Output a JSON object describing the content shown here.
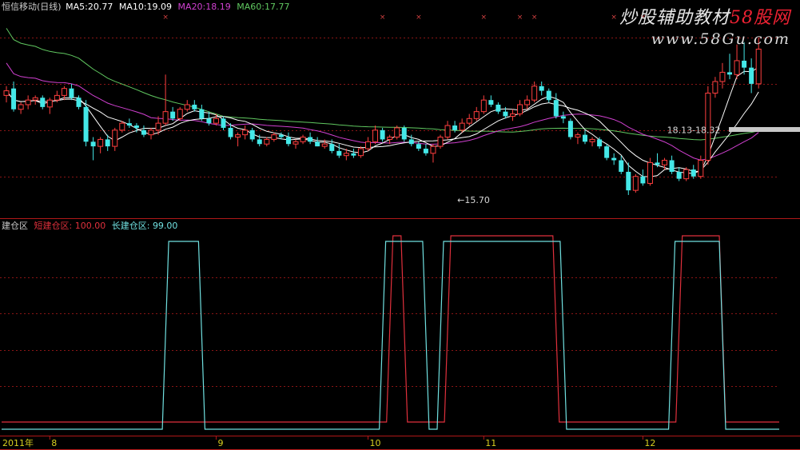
{
  "colors": {
    "background": "#000000",
    "up": "#ff3f3f",
    "down": "#44e8e8",
    "ma5": "#ffffff",
    "ma10": "#ffffff",
    "ma20": "#d040d0",
    "ma60": "#60c860",
    "grid": "#8a1515",
    "text": "#cccccc",
    "short_zone": "#e0303c",
    "long_zone": "#70e0e0"
  },
  "watermark": {
    "line1_a": "炒股辅助教材",
    "line1_b": "58股网",
    "line2": "www.58Gu.com"
  },
  "chart_data": [
    {
      "type": "candlestick",
      "title": "恒信移动(日线)",
      "legend": [
        {
          "label": "MA5:",
          "value": "20.77",
          "color_key": "ma5"
        },
        {
          "label": "MA10:",
          "value": "19.09",
          "color_key": "ma10"
        },
        {
          "label": "MA20:",
          "value": "18.19",
          "color_key": "ma20"
        },
        {
          "label": "MA60:",
          "value": "17.77",
          "color_key": "ma60"
        }
      ],
      "ylim": [
        14.8,
        23.5
      ],
      "grid": true,
      "annotations": [
        {
          "text": "←15.70",
          "x": 63,
          "y": 15.7
        },
        {
          "text": "18.13-18.32",
          "x": 92,
          "y": 18.3
        }
      ],
      "candles": [
        [
          20.0,
          20.4,
          19.7,
          20.2
        ],
        [
          20.3,
          20.6,
          19.3,
          19.4
        ],
        [
          19.4,
          19.7,
          19.2,
          19.6
        ],
        [
          19.6,
          20.0,
          19.4,
          19.8
        ],
        [
          19.8,
          20.0,
          19.6,
          19.9
        ],
        [
          19.9,
          20.0,
          19.4,
          19.5
        ],
        [
          19.5,
          19.9,
          19.2,
          19.8
        ],
        [
          19.8,
          20.2,
          19.7,
          20.0
        ],
        [
          20.0,
          20.4,
          19.8,
          20.3
        ],
        [
          20.3,
          20.5,
          19.8,
          19.9
        ],
        [
          19.9,
          20.0,
          19.4,
          19.5
        ],
        [
          19.5,
          19.8,
          17.8,
          18.0
        ],
        [
          18.0,
          18.2,
          17.2,
          17.8
        ],
        [
          17.8,
          18.2,
          17.5,
          18.1
        ],
        [
          18.1,
          18.3,
          17.6,
          17.8
        ],
        [
          17.8,
          18.6,
          17.6,
          18.5
        ],
        [
          18.5,
          18.9,
          18.4,
          18.8
        ],
        [
          18.8,
          19.0,
          18.6,
          18.7
        ],
        [
          18.7,
          18.8,
          18.4,
          18.6
        ],
        [
          18.5,
          18.7,
          18.2,
          18.3
        ],
        [
          18.3,
          18.6,
          18.1,
          18.5
        ],
        [
          18.5,
          19.1,
          18.3,
          18.8
        ],
        [
          18.8,
          20.9,
          18.7,
          19.3
        ],
        [
          19.3,
          19.5,
          18.9,
          19.0
        ],
        [
          19.0,
          19.5,
          18.9,
          19.4
        ],
        [
          19.4,
          19.8,
          19.3,
          19.6
        ],
        [
          19.6,
          19.8,
          19.3,
          19.4
        ],
        [
          19.4,
          19.6,
          18.9,
          19.0
        ],
        [
          19.0,
          19.3,
          18.7,
          18.8
        ],
        [
          18.8,
          19.2,
          18.7,
          19.0
        ],
        [
          19.0,
          19.1,
          18.5,
          18.6
        ],
        [
          18.6,
          18.8,
          18.1,
          18.2
        ],
        [
          18.2,
          18.4,
          17.8,
          18.3
        ],
        [
          18.3,
          18.7,
          18.1,
          18.5
        ],
        [
          18.5,
          18.6,
          18.0,
          18.1
        ],
        [
          18.1,
          18.3,
          17.8,
          17.9
        ],
        [
          17.9,
          18.2,
          17.8,
          18.1
        ],
        [
          18.1,
          18.4,
          18.0,
          18.3
        ],
        [
          18.3,
          18.4,
          18.1,
          18.2
        ],
        [
          18.2,
          18.4,
          17.8,
          17.9
        ],
        [
          17.9,
          18.1,
          17.7,
          18.0
        ],
        [
          18.0,
          18.3,
          17.9,
          18.2
        ],
        [
          18.2,
          18.4,
          17.9,
          18.0
        ],
        [
          18.0,
          18.2,
          17.8,
          17.8
        ],
        [
          17.8,
          18.1,
          17.7,
          17.9
        ],
        [
          17.9,
          18.1,
          17.5,
          17.6
        ],
        [
          17.6,
          17.9,
          17.3,
          17.4
        ],
        [
          17.4,
          17.7,
          17.2,
          17.5
        ],
        [
          17.5,
          17.7,
          17.3,
          17.4
        ],
        [
          17.4,
          17.8,
          17.3,
          17.7
        ],
        [
          17.7,
          18.2,
          17.6,
          18.0
        ],
        [
          18.0,
          18.7,
          17.9,
          18.5
        ],
        [
          18.5,
          18.6,
          18.0,
          18.1
        ],
        [
          18.1,
          18.3,
          17.9,
          18.2
        ],
        [
          18.2,
          18.7,
          18.1,
          18.6
        ],
        [
          18.6,
          18.7,
          18.0,
          18.1
        ],
        [
          18.1,
          18.3,
          17.8,
          17.9
        ],
        [
          17.9,
          18.0,
          17.6,
          17.7
        ],
        [
          17.7,
          17.9,
          17.4,
          17.5
        ],
        [
          17.5,
          17.9,
          17.1,
          17.8
        ],
        [
          17.8,
          18.3,
          17.7,
          18.2
        ],
        [
          18.2,
          18.9,
          18.1,
          18.7
        ],
        [
          18.7,
          18.9,
          18.4,
          18.5
        ],
        [
          18.5,
          19.0,
          18.4,
          18.8
        ],
        [
          18.8,
          19.2,
          18.7,
          19.0
        ],
        [
          19.0,
          19.5,
          18.9,
          19.3
        ],
        [
          19.3,
          20.0,
          19.2,
          19.8
        ],
        [
          19.8,
          20.0,
          19.5,
          19.6
        ],
        [
          19.6,
          19.7,
          19.2,
          19.3
        ],
        [
          19.3,
          19.5,
          19.0,
          19.1
        ],
        [
          19.1,
          19.4,
          18.9,
          19.2
        ],
        [
          19.2,
          19.8,
          19.1,
          19.6
        ],
        [
          19.6,
          20.0,
          19.4,
          19.8
        ],
        [
          19.8,
          20.6,
          19.7,
          20.4
        ],
        [
          20.4,
          20.6,
          20.0,
          20.2
        ],
        [
          20.2,
          20.3,
          19.7,
          19.8
        ],
        [
          19.8,
          20.1,
          19.0,
          19.1
        ],
        [
          19.1,
          19.3,
          18.8,
          19.0
        ],
        [
          18.9,
          19.0,
          18.1,
          18.2
        ],
        [
          18.2,
          18.4,
          17.9,
          18.3
        ],
        [
          18.3,
          18.5,
          17.9,
          18.0
        ],
        [
          18.0,
          18.2,
          17.8,
          18.1
        ],
        [
          18.1,
          18.2,
          17.7,
          17.8
        ],
        [
          17.8,
          17.9,
          17.2,
          17.3
        ],
        [
          17.3,
          17.5,
          17.0,
          17.2
        ],
        [
          17.2,
          17.4,
          16.6,
          16.7
        ],
        [
          16.7,
          17.1,
          15.7,
          15.9
        ],
        [
          15.9,
          16.6,
          15.8,
          16.5
        ],
        [
          16.5,
          16.8,
          16.1,
          16.2
        ],
        [
          16.2,
          17.3,
          16.1,
          17.1
        ],
        [
          17.1,
          17.5,
          16.9,
          17.0
        ],
        [
          17.0,
          17.3,
          16.8,
          17.2
        ],
        [
          17.2,
          17.4,
          16.6,
          16.7
        ],
        [
          16.7,
          16.9,
          16.3,
          16.4
        ],
        [
          16.4,
          16.9,
          16.3,
          16.8
        ],
        [
          16.8,
          17.0,
          16.4,
          16.5
        ],
        [
          16.5,
          17.4,
          16.4,
          17.2
        ],
        [
          17.2,
          20.4,
          17.0,
          20.1
        ],
        [
          20.1,
          20.8,
          19.9,
          20.6
        ],
        [
          20.6,
          21.4,
          20.3,
          21.0
        ],
        [
          21.0,
          21.8,
          20.7,
          20.9
        ],
        [
          20.9,
          22.2,
          20.7,
          21.5
        ],
        [
          21.5,
          22.3,
          20.9,
          21.2
        ],
        [
          21.2,
          21.6,
          20.1,
          20.5
        ],
        [
          20.5,
          22.5,
          20.3,
          22.0
        ]
      ]
    },
    {
      "type": "line",
      "title": "建仓区",
      "series": [
        {
          "name": "短建仓区:",
          "value_label": "100.00",
          "color_key": "short_zone",
          "zones": [
            [
              53,
              55
            ],
            [
              61,
              76
            ],
            [
              93,
              99
            ]
          ]
        },
        {
          "name": "长建仓区:",
          "value_label": "99.00",
          "color_key": "long_zone",
          "zones": [
            [
              22,
              27
            ],
            [
              52,
              58
            ],
            [
              60,
              77
            ],
            [
              92,
              99
            ]
          ]
        }
      ],
      "ylim": [
        0,
        100
      ],
      "grid": true
    }
  ],
  "x_axis": {
    "labels": [
      {
        "text": "2011年",
        "x": -1
      },
      {
        "text": "8",
        "x": 6
      },
      {
        "text": "9",
        "x": 29
      },
      {
        "text": "10",
        "x": 50
      },
      {
        "text": "11",
        "x": 66
      },
      {
        "text": "12",
        "x": 88
      }
    ]
  }
}
